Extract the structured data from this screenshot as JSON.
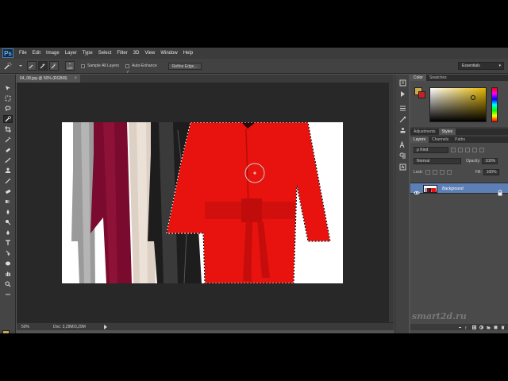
{
  "app": {
    "logo_text": "Ps",
    "menu": [
      "File",
      "Edit",
      "Image",
      "Layer",
      "Type",
      "Select",
      "Filter",
      "3D",
      "View",
      "Window",
      "Help"
    ]
  },
  "options_bar": {
    "brush_size": "100",
    "sample_all_layers_label": "Sample All Layers",
    "sample_all_layers_checked": false,
    "auto_enhance_label": "Auto-Enhance",
    "auto_enhance_checked": true,
    "refine_edge_label": "Refine Edge...",
    "workspace": "Essentials"
  },
  "document": {
    "tab_title": "04_08.jpg @ 50% (RGB/8)",
    "tab_close": "×",
    "zoom": "50%",
    "doc_size": "Doc: 3,29M/3,29M"
  },
  "color_panel": {
    "tabs": [
      "Color",
      "Swatches"
    ],
    "foreground": "#c9a94d",
    "background": "#c81f1f"
  },
  "adjustments_panel": {
    "tabs": [
      "Adjustments",
      "Styles"
    ]
  },
  "layers_panel": {
    "tabs": [
      "Layers",
      "Channels",
      "Paths"
    ],
    "filter": "ρ Kind",
    "blend_mode": "Normal",
    "opacity_label": "Opacity:",
    "opacity": "100%",
    "lock_label": "Lock:",
    "fill_label": "Fill:",
    "fill": "100%",
    "layers": [
      {
        "name": "Background",
        "visible": true,
        "locked": true
      }
    ]
  },
  "watermark": "smart2d.ru",
  "colors": {
    "selection_marching_ants": "#ffffff",
    "accent_layer_selected": "#5c7fb5"
  }
}
